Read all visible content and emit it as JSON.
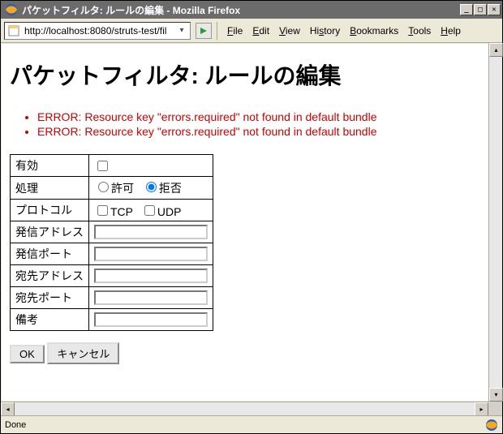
{
  "window": {
    "title": "パケットフィルタ: ルールの編集 - Mozilla Firefox"
  },
  "toolbar": {
    "url": "http://localhost:8080/struts-test/fil",
    "menu": {
      "file": "File",
      "edit": "Edit",
      "view": "View",
      "history": "History",
      "bookmarks": "Bookmarks",
      "tools": "Tools",
      "help": "Help"
    }
  },
  "page": {
    "heading": "パケットフィルタ: ルールの編集",
    "errors": [
      "ERROR: Resource key \"errors.required\" not found in default bundle",
      "ERROR: Resource key \"errors.required\" not found in default bundle"
    ],
    "form": {
      "rows": {
        "enabled": "有効",
        "action": "処理",
        "protocol": "プロトコル",
        "src_addr": "発信アドレス",
        "src_port": "発信ポート",
        "dst_addr": "宛先アドレス",
        "dst_port": "宛先ポート",
        "remarks": "備考"
      },
      "radios": {
        "allow": "許可",
        "deny": "拒否"
      },
      "checks": {
        "tcp": "TCP",
        "udp": "UDP"
      },
      "values": {
        "enabled": false,
        "action_selected": "deny",
        "tcp": false,
        "udp": false,
        "src_addr": "",
        "src_port": "",
        "dst_addr": "",
        "dst_port": "",
        "remarks": ""
      },
      "buttons": {
        "ok": "OK",
        "cancel": "キャンセル"
      }
    }
  },
  "status": {
    "text": "Done"
  }
}
